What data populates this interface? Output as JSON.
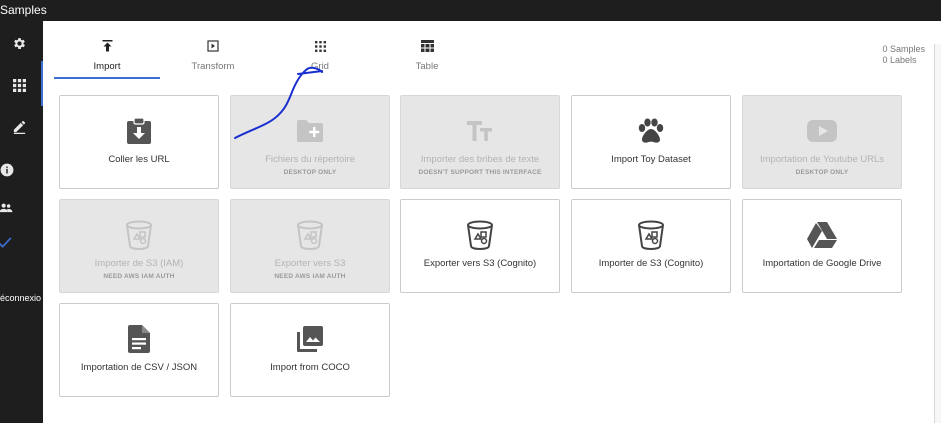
{
  "app": {
    "title": "Samples"
  },
  "sidebar": {
    "items": [
      {
        "name": "settings",
        "icon": "gear-icon"
      },
      {
        "name": "grid",
        "icon": "apps-icon"
      },
      {
        "name": "edit",
        "icon": "pencil-icon"
      },
      {
        "name": "info",
        "icon": "info-icon"
      },
      {
        "name": "users",
        "icon": "people-icon"
      },
      {
        "name": "check",
        "icon": "check-icon"
      }
    ],
    "logout_label": "éconnexio"
  },
  "tabs": [
    {
      "label": "Import",
      "icon": "upload-icon",
      "active": true
    },
    {
      "label": "Transform",
      "icon": "play-box-icon",
      "active": false
    },
    {
      "label": "Grid",
      "icon": "grid-dots-icon",
      "active": false
    },
    {
      "label": "Table",
      "icon": "table-icon",
      "active": false
    }
  ],
  "counts": {
    "samples": "0 Samples",
    "labels": "0 Labels"
  },
  "cards": [
    {
      "title": "Coller les URL",
      "sub": "",
      "icon": "clipboard-download-icon",
      "disabled": false
    },
    {
      "title": "Fichiers du répertoire",
      "sub": "DESKTOP ONLY",
      "icon": "folder-plus-icon",
      "disabled": true
    },
    {
      "title": "Importer des bribes de texte",
      "sub": "DOESN'T SUPPORT THIS INTERFACE",
      "icon": "text-size-icon",
      "disabled": true
    },
    {
      "title": "Import Toy Dataset",
      "sub": "",
      "icon": "paw-icon",
      "disabled": false
    },
    {
      "title": "Importation de Youtube URLs",
      "sub": "DESKTOP ONLY",
      "icon": "youtube-icon",
      "disabled": true
    },
    {
      "title": "Importer de S3 (IAM)",
      "sub": "NEED AWS IAM AUTH",
      "icon": "s3-bucket-icon",
      "disabled": true
    },
    {
      "title": "Exporter vers S3",
      "sub": "NEED AWS IAM AUTH",
      "icon": "s3-bucket-icon",
      "disabled": true
    },
    {
      "title": "Exporter vers S3 (Cognito)",
      "sub": "",
      "icon": "s3-bucket-icon",
      "disabled": false
    },
    {
      "title": "Importer de S3 (Cognito)",
      "sub": "",
      "icon": "s3-bucket-icon",
      "disabled": false
    },
    {
      "title": "Importation de Google Drive",
      "sub": "",
      "icon": "google-drive-icon",
      "disabled": false
    },
    {
      "title": "Importation de CSV / JSON",
      "sub": "",
      "icon": "file-document-icon",
      "disabled": false
    },
    {
      "title": "Import from COCO",
      "sub": "",
      "icon": "image-multiple-icon",
      "disabled": false
    }
  ],
  "colors": {
    "accent": "#3b6fd4",
    "sidebar": "#1e1e1e",
    "disabled_bg": "#e6e6e6",
    "scribble": "#1a2fd0"
  }
}
